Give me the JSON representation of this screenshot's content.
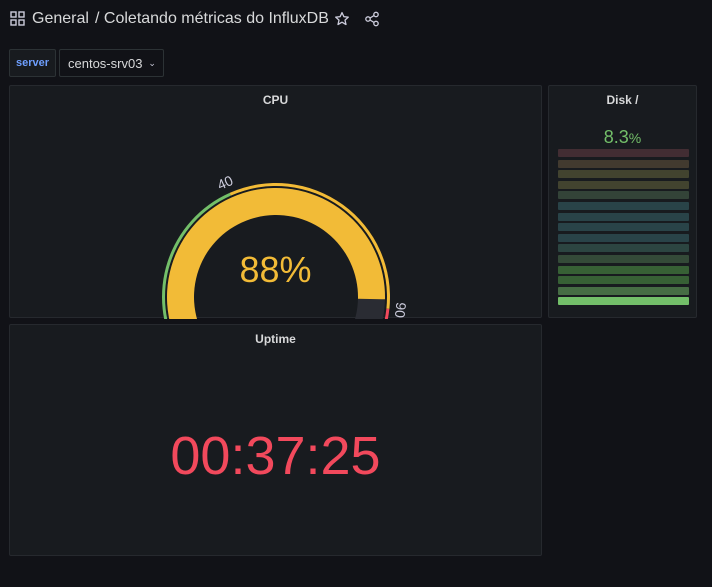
{
  "header": {
    "folder": "General",
    "separator": "/",
    "title": "Coletando métricas do InfluxDB",
    "icons": [
      "apps-grid-icon",
      "star-icon",
      "share-icon"
    ]
  },
  "variables": {
    "label": "server",
    "value": "centos-srv03"
  },
  "panels": {
    "cpu": {
      "title": "CPU",
      "value": "88%",
      "gauge": {
        "min": 0,
        "max": 100,
        "current": 88,
        "thresholds": [
          0,
          40,
          90,
          100
        ]
      },
      "colors": {
        "value": "#f2bb37",
        "green": "#73bf69",
        "yellow": "#f2bb37",
        "red": "#f2495c",
        "track": "#2a2c33"
      }
    },
    "disk": {
      "title": "Disk /",
      "value": "8.3",
      "unit": "%",
      "level_percent": 8.3,
      "colors": {
        "value": "#73bf69"
      }
    },
    "uptime": {
      "title": "Uptime",
      "value": "00:37:25",
      "colors": {
        "value": "#f2495c"
      }
    }
  }
}
